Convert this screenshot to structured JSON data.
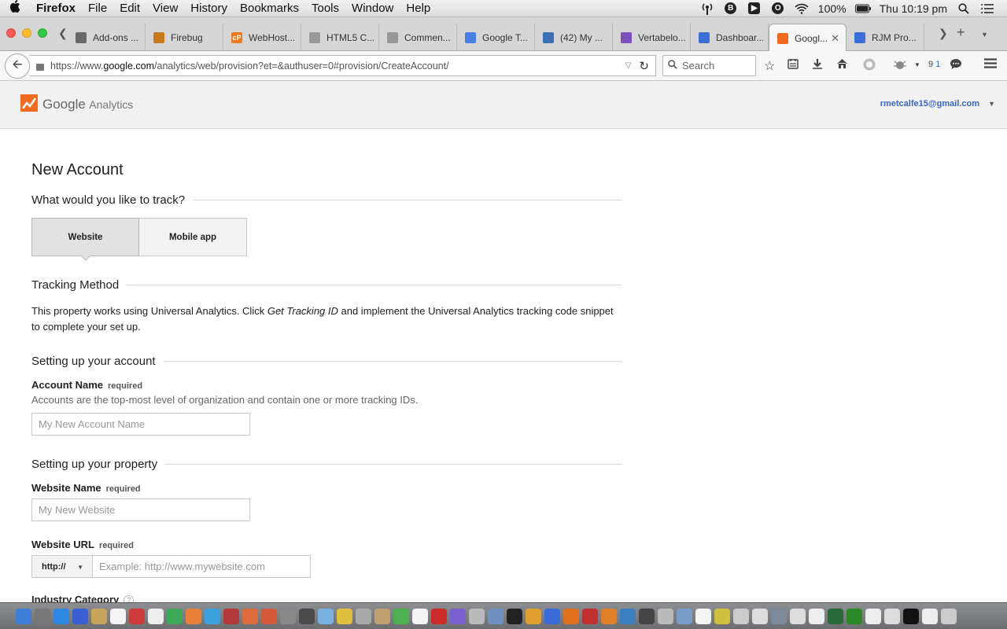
{
  "menubar": {
    "apple": "",
    "app_name": "Firefox",
    "menus": [
      "File",
      "Edit",
      "View",
      "History",
      "Bookmarks",
      "Tools",
      "Window",
      "Help"
    ],
    "icons": [
      "signal-icon",
      "b-circle-icon",
      "airplay-icon",
      "o-circle-icon",
      "wifi-icon"
    ],
    "battery": "100%",
    "clock": "Thu 10:19 pm"
  },
  "tabs": [
    {
      "label": "Add-ons ...",
      "icon": "puzzle-icon",
      "color": "#6a6a6a"
    },
    {
      "label": "Firebug",
      "icon": "bug-icon",
      "color": "#c9781d"
    },
    {
      "label": "WebHost...",
      "icon": "cpanel-icon",
      "color": "#f07a1c",
      "glyph": "cP"
    },
    {
      "label": "HTML5 C...",
      "icon": "gear-icon",
      "color": "#999"
    },
    {
      "label": "Commen...",
      "icon": "gear-icon",
      "color": "#999"
    },
    {
      "label": "Google T...",
      "icon": "translate-icon",
      "color": "#4a7de8"
    },
    {
      "label": "(42) My ...",
      "icon": "globe-icon",
      "color": "#3d6fb8"
    },
    {
      "label": "Vertabelo...",
      "icon": "vertabelo-icon",
      "color": "#7b4fb5"
    },
    {
      "label": "Dashboar...",
      "icon": "blog-icon",
      "color": "#3d6fd8"
    },
    {
      "label": "Googl...",
      "icon": "analytics-icon",
      "color": "#f06b1f",
      "active": true
    },
    {
      "label": "RJM Pro...",
      "icon": "blog-icon",
      "color": "#3d6fd8"
    }
  ],
  "navbar": {
    "url_prefix": "https://www.",
    "url_domain": "google.com",
    "url_rest": "/analytics/web/provision?et=&authuser=0#provision/CreateAccount/",
    "search_placeholder": "Search",
    "counter_a": "9",
    "counter_b": "1"
  },
  "ga": {
    "brand_google": "Google",
    "brand_product": "Analytics",
    "user_email": "rmetcalfe15@gmail.com"
  },
  "form": {
    "page_title": "New Account",
    "track_question": "What would you like to track?",
    "toggle_website": "Website",
    "toggle_mobile": "Mobile app",
    "tracking_method": "Tracking Method",
    "tracking_desc_1": "This property works using Universal Analytics. Click ",
    "tracking_desc_em": "Get Tracking ID",
    "tracking_desc_2": " and implement the Universal Analytics tracking code snippet to complete your set up.",
    "account_section": "Setting up your account",
    "account_name_label": "Account Name",
    "required": "required",
    "account_name_help": "Accounts are the top-most level of organization and contain one or more tracking IDs.",
    "account_name_placeholder": "My New Account Name",
    "property_section": "Setting up your property",
    "website_name_label": "Website Name",
    "website_name_placeholder": "My New Website",
    "website_url_label": "Website URL",
    "protocol": "http://",
    "website_url_placeholder": "Example: http://www.mywebsite.com",
    "industry_label": "Industry Category",
    "help_glyph": "?"
  },
  "colors": {
    "ga_orange": "#f06b1f",
    "link_blue": "#3a67c6"
  }
}
